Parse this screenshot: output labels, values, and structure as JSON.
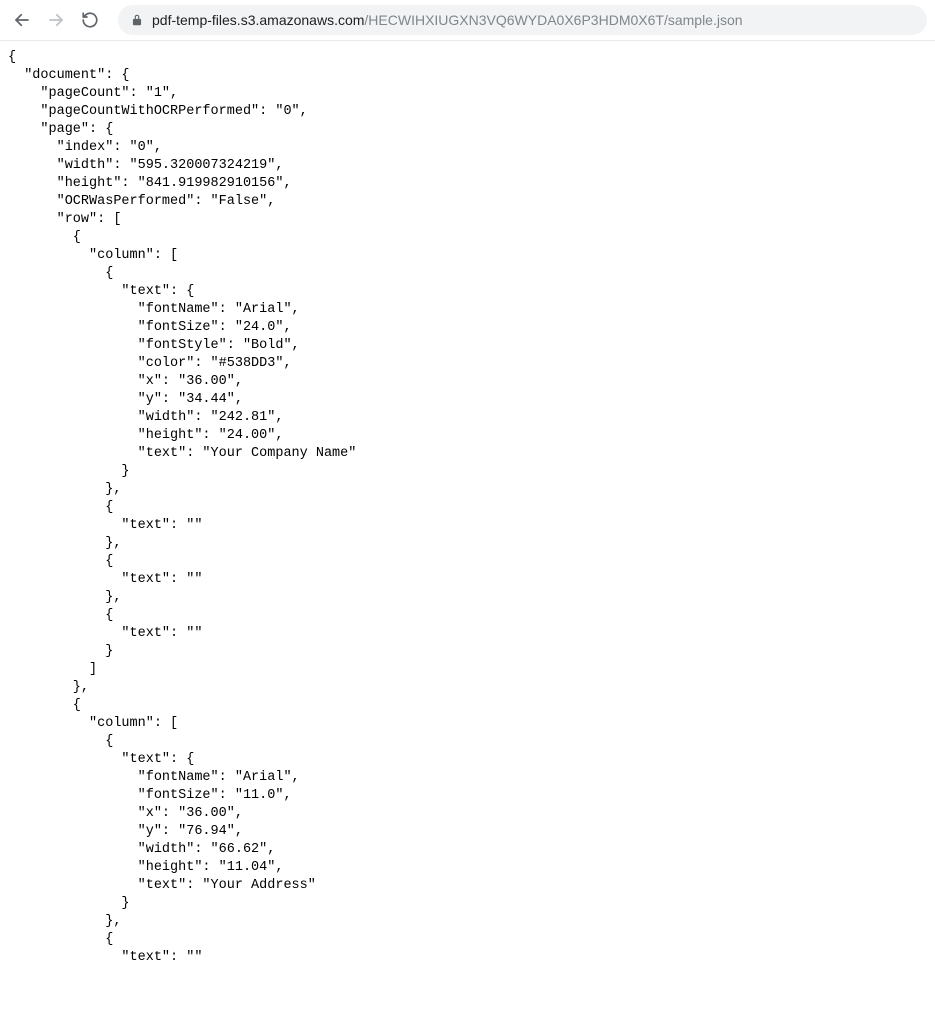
{
  "toolbar": {
    "url_domain": "pdf-temp-files.s3.amazonaws.com",
    "url_path": "/HECWIHXIUGXN3VQ6WYDA0X6P3HDM0X6T/sample.json"
  },
  "json_body": "{\n  \"document\": {\n    \"pageCount\": \"1\",\n    \"pageCountWithOCRPerformed\": \"0\",\n    \"page\": {\n      \"index\": \"0\",\n      \"width\": \"595.320007324219\",\n      \"height\": \"841.919982910156\",\n      \"OCRWasPerformed\": \"False\",\n      \"row\": [\n        {\n          \"column\": [\n            {\n              \"text\": {\n                \"fontName\": \"Arial\",\n                \"fontSize\": \"24.0\",\n                \"fontStyle\": \"Bold\",\n                \"color\": \"#538DD3\",\n                \"x\": \"36.00\",\n                \"y\": \"34.44\",\n                \"width\": \"242.81\",\n                \"height\": \"24.00\",\n                \"text\": \"Your Company Name\"\n              }\n            },\n            {\n              \"text\": \"\"\n            },\n            {\n              \"text\": \"\"\n            },\n            {\n              \"text\": \"\"\n            }\n          ]\n        },\n        {\n          \"column\": [\n            {\n              \"text\": {\n                \"fontName\": \"Arial\",\n                \"fontSize\": \"11.0\",\n                \"x\": \"36.00\",\n                \"y\": \"76.94\",\n                \"width\": \"66.62\",\n                \"height\": \"11.04\",\n                \"text\": \"Your Address\"\n              }\n            },\n            {\n              \"text\": \"\""
}
